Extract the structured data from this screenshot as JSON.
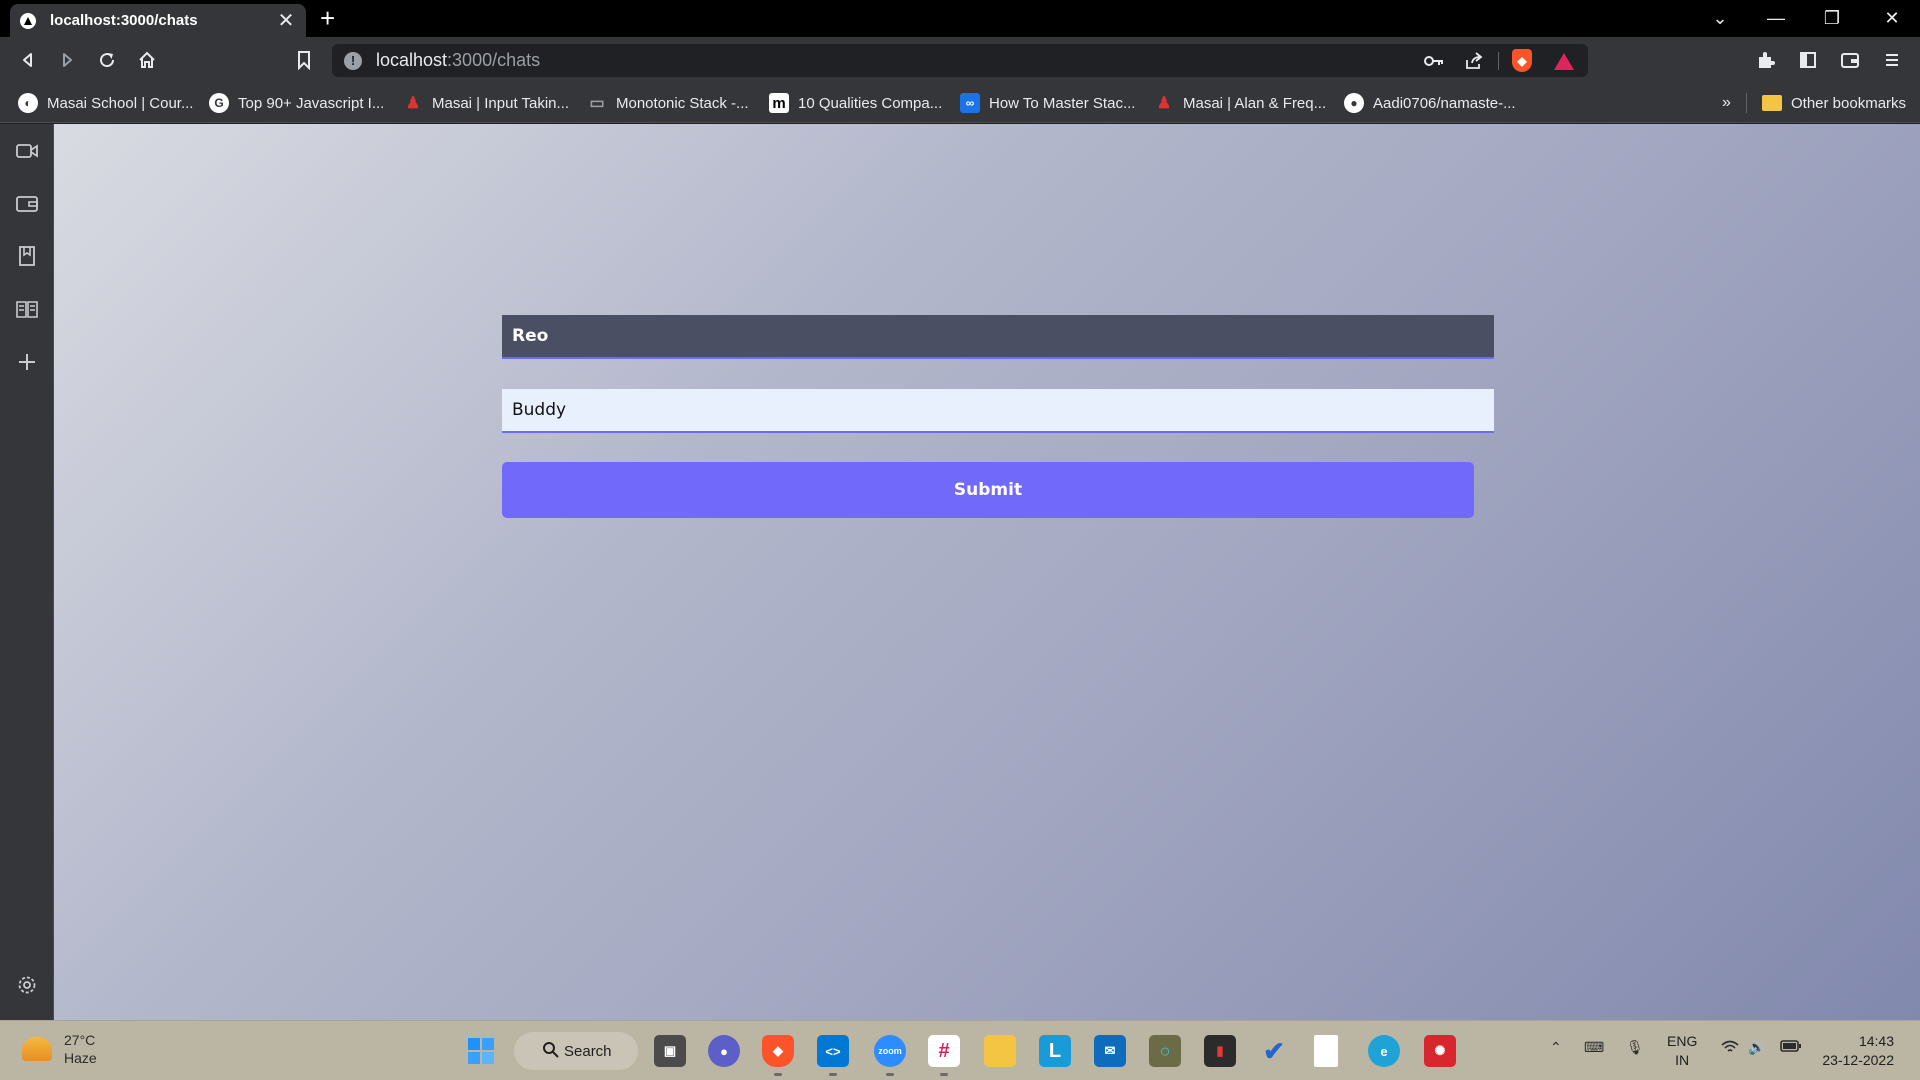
{
  "browser": {
    "tab_title": "localhost:3000/chats",
    "url_host": "localhost",
    "url_path": ":3000/chats",
    "new_tab_label": "+"
  },
  "bookmarks": [
    {
      "label": "Masai School | Cour...",
      "icon": "globe-icon",
      "color": "#ffffff"
    },
    {
      "label": "Top 90+ Javascript I...",
      "icon": "g-logo-icon",
      "color": "#ffffff"
    },
    {
      "label": "Masai | Input Takin...",
      "icon": "masai-icon",
      "color": "#d33"
    },
    {
      "label": "Monotonic Stack -...",
      "icon": "laptop-icon",
      "color": "#9aa0a6"
    },
    {
      "label": "10 Qualities Compa...",
      "icon": "medium-icon",
      "color": "#000"
    },
    {
      "label": "How To Master Stac...",
      "icon": "infinity-icon",
      "color": "#1a73e8"
    },
    {
      "label": "Masai | Alan & Freq...",
      "icon": "masai-icon",
      "color": "#d33"
    },
    {
      "label": "Aadi0706/namaste-...",
      "icon": "github-icon",
      "color": "#ffffff"
    }
  ],
  "bookmarks_overflow": "»",
  "other_bookmarks": "Other bookmarks",
  "form": {
    "first_value": "Reo",
    "second_value": "Buddy",
    "submit_label": "Submit"
  },
  "taskbar": {
    "temperature": "27°C",
    "weather": "Haze",
    "search_label": "Search",
    "language_1": "ENG",
    "language_2": "IN",
    "time": "14:43",
    "date": "23-12-2022"
  }
}
